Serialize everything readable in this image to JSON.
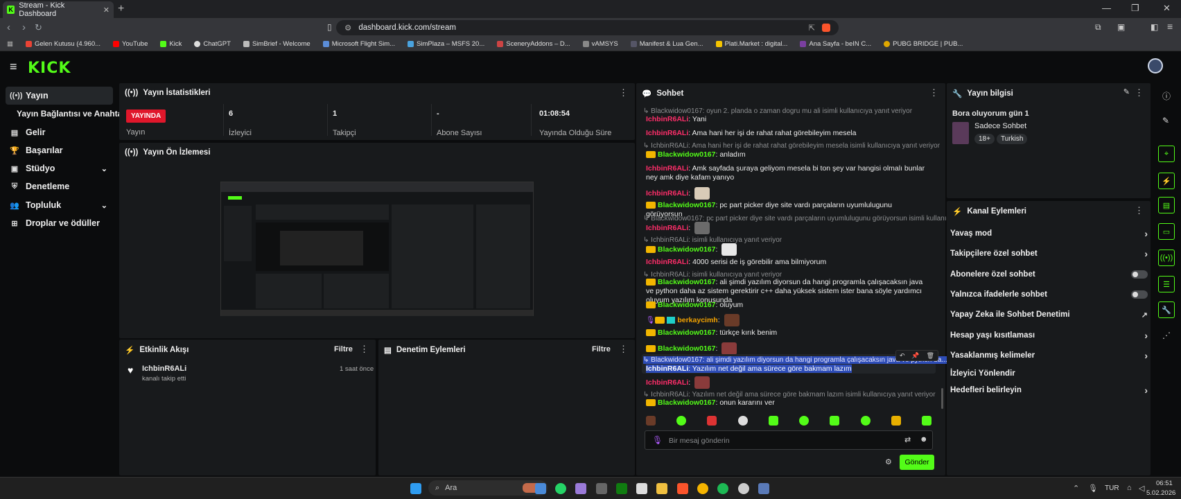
{
  "browser": {
    "tab_title": "Stream - Kick Dashboard",
    "url": "dashboard.kick.com/stream",
    "bookmarks": [
      "Gelen Kutusu (4.960...",
      "YouTube",
      "Kick",
      "ChatGPT",
      "SimBrief - Welcome",
      "Microsoft Flight Sim...",
      "SimPlaza – MSFS 20...",
      "SceneryAddons – D...",
      "vAMSYS",
      "Manifest & Lua Gen...",
      "Plati.Market : digital...",
      "Ana Sayfa - beIN C...",
      "PUBG BRIDGE | PUB..."
    ]
  },
  "brand": {
    "logo": "KICK",
    "accent": "#53fc18"
  },
  "sidebar": {
    "items": [
      {
        "label": "Yayın",
        "icon": "broadcast-icon"
      },
      {
        "label": "Yayın Bağlantısı ve Anahtarı"
      },
      {
        "label": "Gelir",
        "icon": "chart-icon"
      },
      {
        "label": "Başarılar",
        "icon": "trophy-icon"
      },
      {
        "label": "Stüdyo",
        "icon": "studio-icon"
      },
      {
        "label": "Denetleme",
        "icon": "shield-icon"
      },
      {
        "label": "Topluluk",
        "icon": "people-icon"
      },
      {
        "label": "Droplar ve ödüller",
        "icon": "gift-icon"
      }
    ]
  },
  "stats": {
    "title": "Yayın İstatistikleri",
    "status_badge": "YAYINDA",
    "status_label": "Yayın",
    "viewers": "6",
    "viewers_label": "İzleyici",
    "followers": "1",
    "followers_label": "Takipçi",
    "subs": "-",
    "subs_label": "Abone Sayısı",
    "uptime": "01:08:54",
    "uptime_label": "Yayında Olduğu Süre"
  },
  "preview": {
    "title": "Yayın Ön İzlemesi"
  },
  "activity": {
    "title": "Etkinlik Akışı",
    "filter": "Filtre",
    "user": "IchbinR6ALi",
    "action": "kanalı takip etti",
    "time": "1 saat önce"
  },
  "moderation": {
    "title": "Denetim Eylemleri",
    "filter": "Filtre"
  },
  "chat": {
    "title": "Sohbet",
    "placeholder": "Bir mesaj gönderin",
    "send": "Gönder",
    "messages": {
      "r1": "Blackwidow0167: oyun 2. planda o zaman dogru mu ali isimli kullanıcıya yanıt veriyor",
      "m1u": "IchbinR6ALi",
      "m1t": "Yani",
      "r2": "IchbinR6ALi: Ama hani her işi de rahat rahat görebileyim mesela isimli kullanıcıya yanıt veriyor",
      "m2u": "IchbinR6ALi",
      "m2t": "Ama hani her işi de rahat rahat görebileyim mesela",
      "m3u": "Blackwidow0167",
      "m3t": "anladım",
      "m4u": "IchbinR6ALi",
      "m4t": "Amk sayfada şuraya geliyom mesela bi ton şey var hangisi olmalı bunlar ney amk diye kafam yanıyo",
      "m5u": "IchbinR6ALi",
      "m6u": "Blackwidow0167",
      "m6t": "pc part picker diye site vardı parçaların uyumlulugunu görüyorsun",
      "r3": "Blackwidow0167: pc part picker diye site vardı parçaların uyumlulugunu görüyorsun isimli kullanıcıya yan...",
      "m7u": "IchbinR6ALi",
      "r4": "IchbinR6ALi: isimli kullanıcıya yanıt veriyor",
      "m8u": "Blackwidow0167",
      "m9u": "IchbinR6ALi",
      "m9t": "4000 serisi de iş görebilir ama bilmiyorum",
      "r5": "IchbinR6ALi: isimli kullanıcıya yanıt veriyor",
      "m10u": "Blackwidow0167",
      "m10t": "ali şimdi yazılım diyorsun da hangi programla çalışacaksın java ve python daha az sistem gerektirir c++ daha yüksek sistem ister bana söyle yardımcı oluyum yazılım konusunda",
      "m11u": "Blackwidow0167",
      "m11t": "oluyum",
      "m12u": "berkaycimh",
      "m13u": "Blackwidow0167",
      "m13t": "türkçe kırık benim",
      "m14u": "Blackwidow0167",
      "r6": "Blackwidow0167: ali şimdi yazılım diyorsun da hangi programla çalışacaksın java ve python da...",
      "m15u": "IchbinR6ALi",
      "m15t": "Yazılım net değil ama sürece göre bakmam lazım",
      "m16u": "IchbinR6ALi",
      "r7": "IchbinR6ALi: Yazılım net değil ama sürece göre bakmam lazım isimli kullanıcıya yanıt veriyor",
      "m17u": "Blackwidow0167",
      "m17t": "onun kararını ver"
    }
  },
  "info": {
    "title": "Yayın bilgisi",
    "stream_title": "Bora oluyorum gün 1",
    "category": "Sadece Sohbet",
    "tag1": "18+",
    "tag2": "Turkish"
  },
  "channel_actions": {
    "title": "Kanal Eylemleri",
    "items": [
      "Yavaş mod",
      "Takipçilere özel sohbet",
      "Abonelere özel sohbet",
      "Yalnızca ifadelerle sohbet",
      "Yapay Zeka ile Sohbet Denetimi",
      "Hesap yaşı kısıtlaması",
      "Yasaklanmış kelimeler",
      "İzleyici Yönlendir",
      "Hedefleri belirleyin"
    ]
  },
  "taskbar": {
    "search": "Ara",
    "lang": "TUR",
    "time": "06:51",
    "date": "5.02.2026"
  }
}
